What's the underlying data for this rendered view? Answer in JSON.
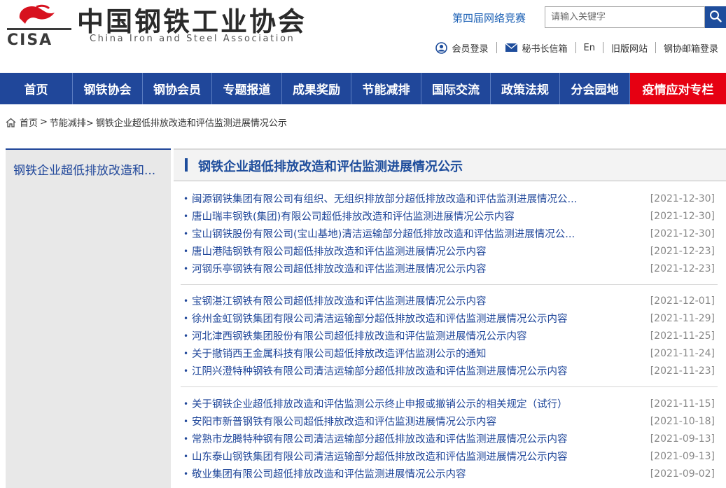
{
  "brand": {
    "logo_text": "CISA",
    "name_cn": "中国钢铁工业协会",
    "name_en": "China Iron and Steel Association",
    "colors": {
      "logo_red": "#d7121f",
      "logo_dark": "#3a3a3a",
      "nav_blue": "#20479a",
      "nav_red": "#e60012",
      "link_blue": "#1a5fb4"
    }
  },
  "header": {
    "contest_link": "第四届网络竞赛",
    "search": {
      "placeholder": "请输入关键字",
      "button_icon": "search-icon"
    },
    "toplinks": [
      {
        "label": "会员登录",
        "icon": "user-icon"
      },
      {
        "label": "秘书长信箱",
        "icon": "mail-icon"
      },
      {
        "label": "En"
      },
      {
        "label": "旧版网站"
      },
      {
        "label": "钢协邮箱登录"
      }
    ]
  },
  "nav": {
    "items": [
      "首页",
      "钢铁协会",
      "钢协会员",
      "专题报道",
      "成果奖励",
      "节能减排",
      "国际交流",
      "政策法规",
      "分会园地",
      "疫情应对专栏"
    ]
  },
  "breadcrumb": {
    "home": "首页",
    "sep1": ">",
    "section": "节能减排>",
    "current": "钢铁企业超低排放改造和评估监测进展情况公示"
  },
  "sidebar": {
    "items": [
      "钢铁企业超低排放改造和..."
    ]
  },
  "main": {
    "title": "钢铁企业超低排放改造和评估监测进展情况公示",
    "groups": [
      [
        {
          "title": "闽源钢铁集团有限公司有组织、无组织排放部分超低排放改造和评估监测进展情况公...",
          "date": "[2021-12-30]"
        },
        {
          "title": "唐山瑞丰钢铁(集团)有限公司超低排放改造和评估监测进展情况公示内容",
          "date": "[2021-12-30]"
        },
        {
          "title": "宝山钢铁股份有限公司(宝山基地)清洁运输部分超低排放改造和评估监测进展情况公...",
          "date": "[2021-12-30]"
        },
        {
          "title": "唐山港陆钢铁有限公司超低排放改造和评估监测进展情况公示内容",
          "date": "[2021-12-23]"
        },
        {
          "title": "河钢乐亭钢铁有限公司超低排放改造和评估监测进展情况公示内容",
          "date": "[2021-12-23]"
        }
      ],
      [
        {
          "title": "宝钢湛江钢铁有限公司超低排放改造和评估监测进展情况公示内容",
          "date": "[2021-12-01]"
        },
        {
          "title": "徐州金虹钢铁集团有限公司清洁运输部分超低排放改造和评估监测进展情况公示内容",
          "date": "[2021-11-29]"
        },
        {
          "title": "河北津西钢铁集团股份有限公司超低排放改造和评估监测进展情况公示内容",
          "date": "[2021-11-25]"
        },
        {
          "title": "关于撤销西王金属科技有限公司超低排放改造评估监测公示的通知",
          "date": "[2021-11-24]"
        },
        {
          "title": "江阴兴澄特种钢铁有限公司清洁运输部分超低排放改造和评估监测进展情况公示内容",
          "date": "[2021-11-23]"
        }
      ],
      [
        {
          "title": "关于钢铁企业超低排放改造和评估监测公示终止申报或撤销公示的相关规定（试行）",
          "date": "[2021-11-15]"
        },
        {
          "title": "安阳市新普钢铁有限公司超低排放改造和评估监测进展情况公示内容",
          "date": "[2021-10-18]"
        },
        {
          "title": "常熟市龙腾特种钢有限公司清洁运输部分超低排放改造和评估监测进展情况公示内容",
          "date": "[2021-09-13]"
        },
        {
          "title": "山东泰山钢铁集团有限公司清洁运输部分超低排放改造和评估监测进展情况公示内容",
          "date": "[2021-09-13]"
        },
        {
          "title": "敬业集团有限公司超低排放改造和评估监测进展情况公示内容",
          "date": "[2021-09-02]"
        }
      ]
    ]
  }
}
